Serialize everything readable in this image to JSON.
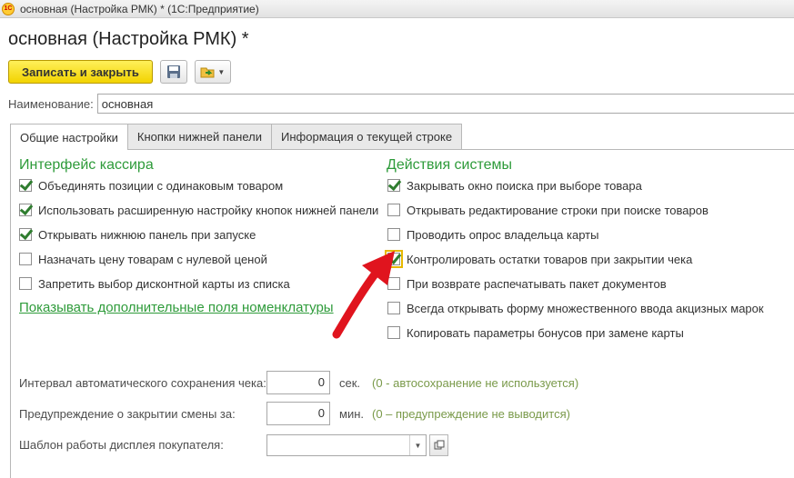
{
  "window": {
    "title": "основная (Настройка РМК) * (1С:Предприятие)",
    "logo_text": "1С"
  },
  "page_title": "основная (Настройка РМК) *",
  "toolbar": {
    "save_close_label": "Записать и закрыть",
    "save_icon": "floppy-disk-icon",
    "more_icon": "go-to-icon"
  },
  "name_field": {
    "label": "Наименование:",
    "value": "основная"
  },
  "tabs": [
    {
      "label": "Общие настройки",
      "active": true
    },
    {
      "label": "Кнопки нижней панели",
      "active": false
    },
    {
      "label": "Информация о текущей строке",
      "active": false
    }
  ],
  "cashier_interface": {
    "title": "Интерфейс кассира",
    "options": [
      {
        "label": "Объединять позиции с одинаковым товаром",
        "checked": true
      },
      {
        "label": "Использовать расширенную настройку кнопок нижней панели",
        "checked": true
      },
      {
        "label": "Открывать нижнюю панель при запуске",
        "checked": true
      },
      {
        "label": "Назначать цену товарам с нулевой ценой",
        "checked": false
      },
      {
        "label": "Запретить выбор дисконтной карты из списка",
        "checked": false
      }
    ],
    "link": "Показывать дополнительные поля номенклатуры"
  },
  "system_actions": {
    "title": "Действия системы",
    "options": [
      {
        "label": "Закрывать окно поиска при выборе товара",
        "checked": true
      },
      {
        "label": "Открывать редактирование строки при поиске товаров",
        "checked": false
      },
      {
        "label": "Проводить опрос владельца карты",
        "checked": false
      },
      {
        "label": "Контролировать остатки товаров при закрытии чека",
        "checked": true
      },
      {
        "label": "При возврате распечатывать пакет документов",
        "checked": false
      },
      {
        "label": "Всегда открывать форму множественного ввода акцизных марок",
        "checked": false
      },
      {
        "label": "Копировать параметры бонусов при замене карты",
        "checked": false
      }
    ]
  },
  "autosave": {
    "label": "Интервал автоматического сохранения чека:",
    "value": "0",
    "unit": "сек.",
    "hint": "(0 - автосохранение не используется)"
  },
  "shift_warning": {
    "label": "Предупреждение о закрытии смены за:",
    "value": "0",
    "unit": "мин.",
    "hint": "(0 – предупреждение не выводится)"
  },
  "display_template": {
    "label": "Шаблон работы дисплея покупателя:",
    "value": ""
  },
  "colors": {
    "accent_green": "#2e9b3a",
    "primary_button": "#f2d300",
    "annotation_arrow": "#e0141e"
  },
  "annotation": {
    "icon": "red-arrow-annotation"
  }
}
